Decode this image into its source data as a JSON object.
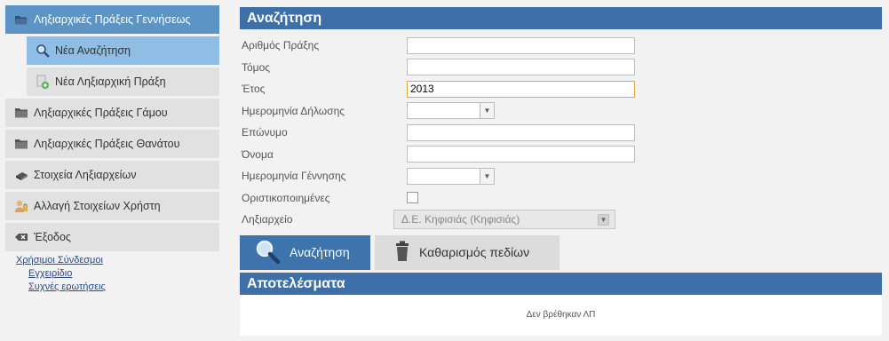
{
  "sidebar": {
    "items": [
      {
        "label": "Ληξιαρχικές Πράξεις Γεννήσεως",
        "icon": "folder-open-icon"
      },
      {
        "label": "Νέα Αναζήτηση",
        "icon": "search-icon"
      },
      {
        "label": "Νέα Ληξιαρχική Πράξη",
        "icon": "add-document-icon"
      },
      {
        "label": "Ληξιαρχικές Πράξεις Γάμου",
        "icon": "folder-icon"
      },
      {
        "label": "Ληξιαρχικές Πράξεις Θανάτου",
        "icon": "folder-icon"
      },
      {
        "label": "Στοιχεία Ληξιαρχείων",
        "icon": "books-icon"
      },
      {
        "label": "Αλλαγή Στοιχείων Χρήστη",
        "icon": "user-lock-icon"
      },
      {
        "label": "Έξοδος",
        "icon": "exit-icon"
      }
    ]
  },
  "links": {
    "title": "Χρήσιμοι Σύνδεσμοι",
    "items": [
      "Εγχειρίδιο",
      "Συχνές ερωτήσεις"
    ]
  },
  "search": {
    "title": "Αναζήτηση",
    "fields": {
      "act_number": {
        "label": "Αριθμός Πράξης",
        "value": ""
      },
      "volume": {
        "label": "Τόμος",
        "value": ""
      },
      "year": {
        "label": "Έτος",
        "value": "2013"
      },
      "declaration_date": {
        "label": "Ημερομηνία Δήλωσης",
        "value": ""
      },
      "surname": {
        "label": "Επώνυμο",
        "value": ""
      },
      "name": {
        "label": "Όνομα",
        "value": ""
      },
      "birth_date": {
        "label": "Ημερομηνία Γέννησης",
        "value": ""
      },
      "finalized": {
        "label": "Οριστικοποιημένες",
        "checked": false
      },
      "registry": {
        "label": "Ληξιαρχείο",
        "value": "Δ.Ε. Κηφισιάς (Κηφισιάς)"
      }
    },
    "search_button": "Αναζήτηση",
    "clear_button": "Καθαρισμός πεδίων"
  },
  "results": {
    "title": "Αποτελέσματα",
    "empty_text": "Δεν βρέθηκαν ΛΠ"
  },
  "colors": {
    "header": "#3d6fa8",
    "active_item": "#5b95c6",
    "active_sub": "#8fbde4",
    "focus_border": "#e3a835"
  }
}
